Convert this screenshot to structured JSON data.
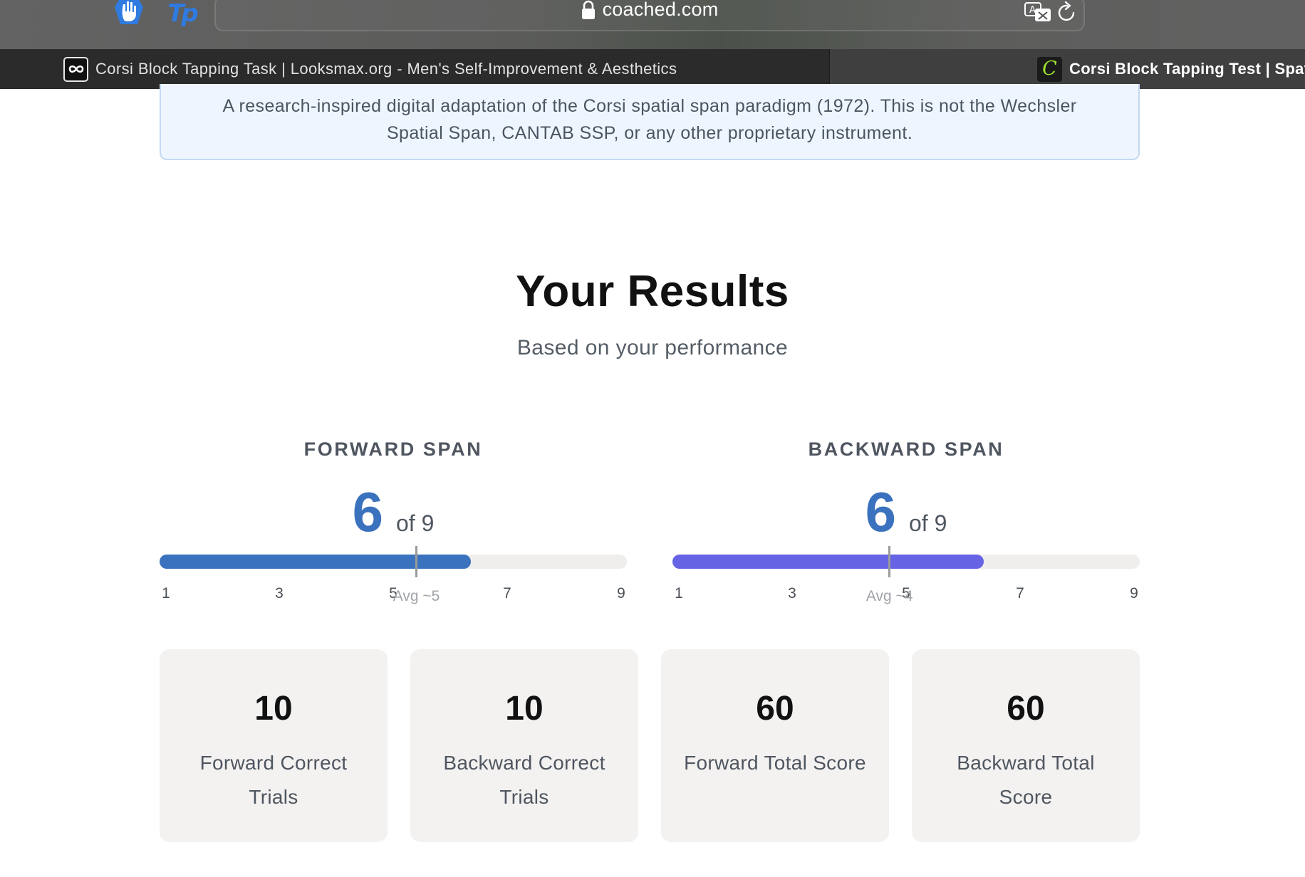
{
  "browser": {
    "url": "coached.com",
    "tabs": [
      {
        "title": "Corsi Block Tapping Task | Looksmax.org - Men's Self-Improvement & Aesthetics",
        "favicon": "infinity-icon",
        "active": false
      },
      {
        "title": "Corsi Block Tapping Test | Spati",
        "favicon": "C",
        "active": true
      }
    ],
    "extensions": [
      "hand-shield-icon",
      "tp-icon"
    ]
  },
  "notice": {
    "line1": "A research-inspired digital adaptation of the Corsi spatial span paradigm (1972). This is not the Wechsler",
    "line2": "Spatial Span, CANTAB SSP, or any other proprietary instrument."
  },
  "results": {
    "title": "Your Results",
    "subtitle": "Based on your performance"
  },
  "spans": [
    {
      "label": "FORWARD SPAN",
      "value": "6",
      "of_text": "of 9",
      "fraction": 0.6667,
      "color": "#3a72bd",
      "avg_label": "Avg ~5",
      "avg_value": 5,
      "ticks": [
        "1",
        "3",
        "5",
        "7",
        "9"
      ]
    },
    {
      "label": "BACKWARD SPAN",
      "value": "6",
      "of_text": "of 9",
      "fraction": 0.6667,
      "color": "#6664e4",
      "avg_label": "Avg ~4",
      "avg_value": 4,
      "ticks": [
        "1",
        "3",
        "5",
        "7",
        "9"
      ]
    }
  ],
  "stats": [
    {
      "value": "10",
      "label": "Forward Correct Trials"
    },
    {
      "value": "10",
      "label": "Backward Correct Trials"
    },
    {
      "value": "60",
      "label": "Forward Total Score"
    },
    {
      "value": "60",
      "label": "Backward Total Score"
    }
  ]
}
